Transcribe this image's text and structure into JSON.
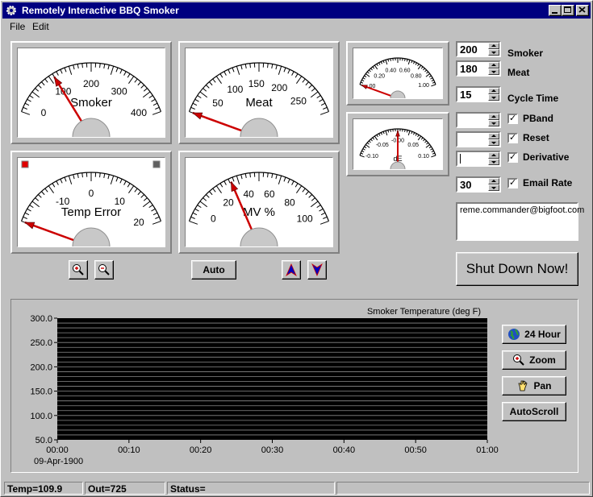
{
  "window": {
    "title": "Remotely Interactive BBQ Smoker",
    "menu": [
      "File",
      "Edit"
    ]
  },
  "gauges": {
    "smoker": {
      "label": "Smoker",
      "ticks": [
        "0",
        "100",
        "200",
        "300",
        "400"
      ],
      "min": 0,
      "max": 400,
      "value": 109.9
    },
    "meat": {
      "label": "Meat",
      "ticks": [
        "50",
        "100",
        "150",
        "200",
        "250"
      ],
      "min": 0,
      "max": 290,
      "value": 0
    },
    "temp_error": {
      "label": "Temp Error",
      "ticks": [
        "-10",
        "0",
        "10",
        "20"
      ],
      "min": -20,
      "max": 20,
      "value": -20
    },
    "mv": {
      "label": "MV %",
      "ticks": [
        "0",
        "20",
        "40",
        "60",
        "80",
        "100"
      ],
      "min": -10,
      "max": 110,
      "value": 30
    },
    "small_top": {
      "ticks": [
        "0.20",
        "0.40",
        "0.60",
        "0.80",
        "1.00",
        ".00"
      ],
      "min": 0,
      "max": 1,
      "value": 0
    },
    "small_bottom": {
      "ticks": [
        "-0.10",
        "-0.05",
        "-0.00",
        "0.05",
        "0.10"
      ],
      "label": "dE",
      "min": -0.1,
      "max": 0.1,
      "value": 0
    }
  },
  "controls": {
    "smoker_setpoint": "200",
    "smoker_label": "Smoker",
    "meat_setpoint": "180",
    "meat_label": "Meat",
    "cycle_time": "15",
    "cycle_time_label": "Cycle Time",
    "pband_label": "PBand",
    "reset_label": "Reset",
    "derivative_label": "Derivative",
    "email_rate": "30",
    "email_rate_label": "Email Rate",
    "check_mark": "✓",
    "email": "reme.commander@bigfoot.com",
    "shutdown_label": "Shut Down Now!",
    "auto_label": "Auto"
  },
  "chart_buttons": {
    "hour24": "24 Hour",
    "zoom": "Zoom",
    "pan": "Pan",
    "autoscroll": "AutoScroll"
  },
  "chart_data": {
    "type": "line",
    "title": "Smoker Temperature (deg F)",
    "ylim": [
      50,
      300
    ],
    "y_ticks": [
      "300.0",
      "250.0",
      "200.0",
      "150.0",
      "100.0",
      "50.0"
    ],
    "x_ticks": [
      "00:00",
      "00:10",
      "00:20",
      "00:30",
      "00:40",
      "00:50",
      "01:00"
    ],
    "x_date": "09-Apr-1900",
    "background": "#000000",
    "grid": true,
    "series": []
  },
  "status": {
    "temp": "Temp=109.9",
    "out": "Out=725",
    "status": "Status="
  },
  "colors": {
    "needle": "#cc0000",
    "title_bar": "#000080"
  }
}
